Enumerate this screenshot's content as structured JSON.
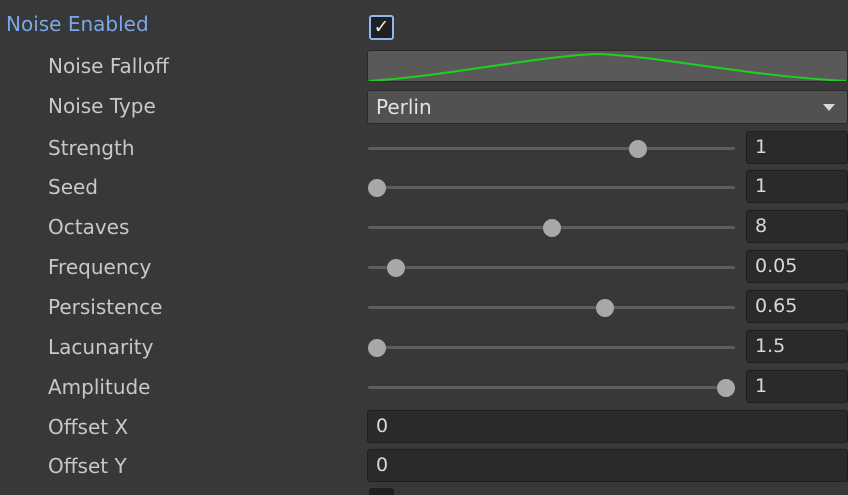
{
  "noise_enabled": {
    "label": "Noise Enabled",
    "checked": true,
    "check_glyph": "✓"
  },
  "falloff": {
    "label": "Noise Falloff",
    "curve_color": "#1ed21e"
  },
  "noise_type": {
    "label": "Noise Type",
    "value": "Perlin"
  },
  "sliders": [
    {
      "key": "strength",
      "label": "Strength",
      "value": "1",
      "fraction": 0.735
    },
    {
      "key": "seed",
      "label": "Seed",
      "value": "1",
      "fraction": 0.025
    },
    {
      "key": "octaves",
      "label": "Octaves",
      "value": "8",
      "fraction": 0.5
    },
    {
      "key": "frequency",
      "label": "Frequency",
      "value": "0.05",
      "fraction": 0.075
    },
    {
      "key": "persistence",
      "label": "Persistence",
      "value": "0.65",
      "fraction": 0.647
    },
    {
      "key": "lacunarity",
      "label": "Lacunarity",
      "value": "1.5",
      "fraction": 0.025
    },
    {
      "key": "amplitude",
      "label": "Amplitude",
      "value": "1",
      "fraction": 0.975
    }
  ],
  "offset_x": {
    "label": "Offset X",
    "value": "0"
  },
  "offset_y": {
    "label": "Offset Y",
    "value": "0"
  },
  "colors": {
    "panel_bg": "#383838",
    "header_label": "#7ba7e8",
    "label": "#c8c8c8",
    "thumb": "#a8a8a8",
    "field_bg": "#2a2a2a"
  }
}
